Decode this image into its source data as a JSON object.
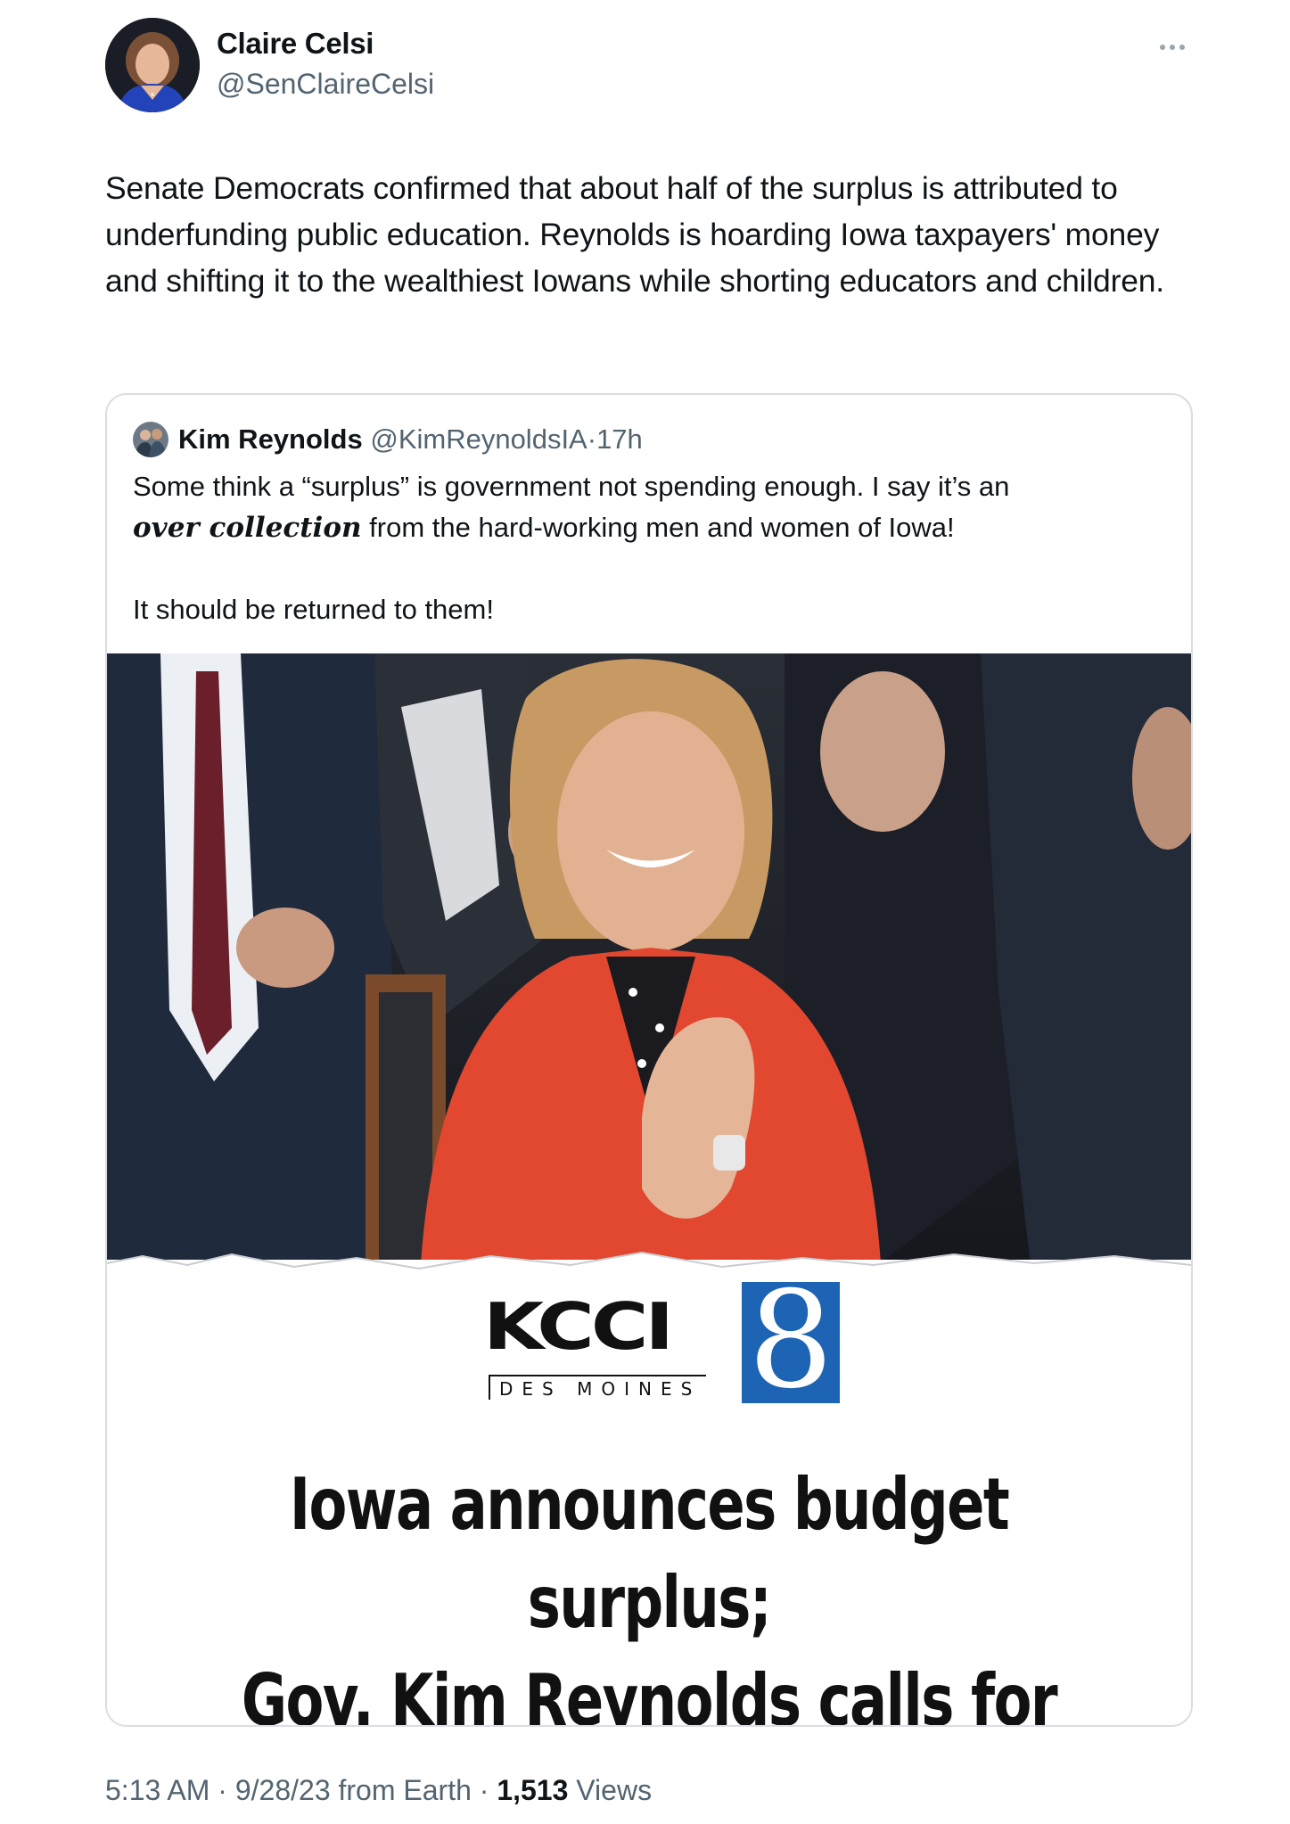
{
  "author": {
    "name": "Claire Celsi",
    "handle": "@SenClaireCelsi"
  },
  "tweet": {
    "text": "Senate Democrats confirmed that about half of the surplus is attributed to underfunding public education. Reynolds is hoarding Iowa taxpayers' money and shifting it to the wealthiest Iowans while shorting educators and children."
  },
  "quoted": {
    "name": "Kim Reynolds",
    "handle": "@KimReynoldsIA",
    "separator": "·",
    "time": "17h",
    "text_part1": "Some think a “surplus” is government not spending enough. I say it’s an",
    "text_emphasis": "over collection",
    "text_part2": " from the hard-working men and women of Iowa!",
    "text_line3": "It should be returned to them!",
    "media": {
      "logo_name": "KCCI",
      "logo_city": "DES MOINES",
      "logo_channel": "8",
      "headline_line1": "Iowa announces budget surplus;",
      "headline_line2": "Gov. Kim Reynolds calls for tax cuts"
    }
  },
  "meta": {
    "time": "5:13 AM",
    "date": "9/28/23",
    "source": "from Earth",
    "views_count": "1,513",
    "views_label": "Views"
  },
  "colors": {
    "text_primary": "#0f1419",
    "text_secondary": "#536471",
    "border": "#d9dee2",
    "jacket_red": "#e2472f",
    "kcci_blue": "#1e64b4"
  }
}
